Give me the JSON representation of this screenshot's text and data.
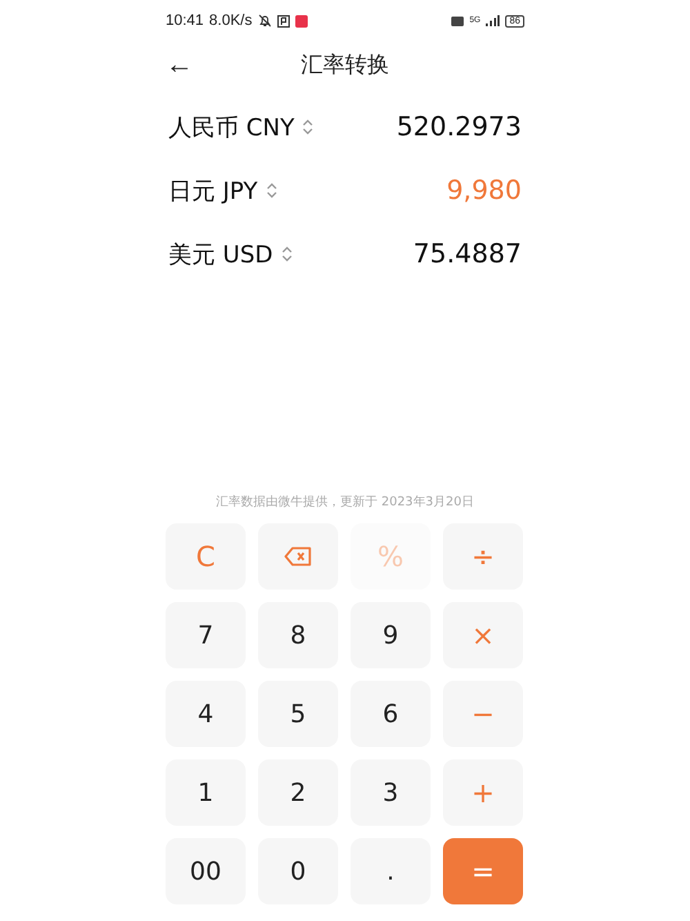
{
  "status_bar": {
    "time": "10:41",
    "speed": "8.0K/s",
    "network": "5G",
    "battery": "86"
  },
  "header": {
    "back": "←",
    "title": "汇率转换"
  },
  "currencies": [
    {
      "name": "人民币 CNY",
      "value": "520.2973",
      "selected": false
    },
    {
      "name": "日元 JPY",
      "value": "9,980",
      "selected": true
    },
    {
      "name": "美元 USD",
      "value": "75.4887",
      "selected": false
    }
  ],
  "note": "汇率数据由微牛提供，更新于 2023年3月20日",
  "keys": [
    {
      "kind": "op",
      "label": "C",
      "disabled": false
    },
    {
      "kind": "backspace",
      "disabled": false
    },
    {
      "kind": "op",
      "label": "%",
      "disabled": true
    },
    {
      "kind": "op",
      "label": "÷",
      "disabled": false
    },
    {
      "kind": "digit",
      "label": "7",
      "disabled": false
    },
    {
      "kind": "digit",
      "label": "8",
      "disabled": false
    },
    {
      "kind": "digit",
      "label": "9",
      "disabled": false
    },
    {
      "kind": "op",
      "label": "×",
      "disabled": false
    },
    {
      "kind": "digit",
      "label": "4",
      "disabled": false
    },
    {
      "kind": "digit",
      "label": "5",
      "disabled": false
    },
    {
      "kind": "digit",
      "label": "6",
      "disabled": false
    },
    {
      "kind": "op",
      "label": "−",
      "disabled": false
    },
    {
      "kind": "digit",
      "label": "1",
      "disabled": false
    },
    {
      "kind": "digit",
      "label": "2",
      "disabled": false
    },
    {
      "kind": "digit",
      "label": "3",
      "disabled": false
    },
    {
      "kind": "op",
      "label": "+",
      "disabled": false
    },
    {
      "kind": "digit",
      "label": "00",
      "disabled": false
    },
    {
      "kind": "digit",
      "label": "0",
      "disabled": false
    },
    {
      "kind": "digit",
      "label": ".",
      "disabled": false
    },
    {
      "kind": "equals",
      "label": "=",
      "disabled": false
    }
  ]
}
